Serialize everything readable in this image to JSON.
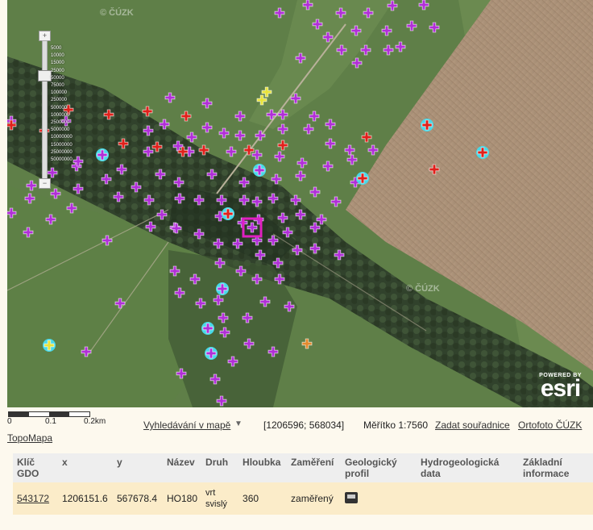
{
  "watermarks": {
    "top": "© ČÚZK",
    "mid": "© ČÚZK"
  },
  "zoom": {
    "plus": "+",
    "minus": "−",
    "scales": [
      "5000",
      "10000",
      "15000",
      "25000",
      "50000",
      "75000",
      "100000",
      "250000",
      "500000",
      "1000000",
      "2500000",
      "5000000",
      "10000000",
      "15000000",
      "25000000",
      "50000000"
    ],
    "level_fraction": 0.23
  },
  "esri": {
    "powered": "POWERED BY",
    "name": "esri"
  },
  "scale": {
    "l0": "0",
    "l1": "0.1",
    "l2": "0.2km"
  },
  "toolbar": {
    "search": "Vyhledávání v mapě",
    "coords": "[1206596; 568034]",
    "scale": "Měřítko 1:7560",
    "enter_coords": "Zadat souřadnice",
    "ortho": "Ortofoto ČÚZK",
    "topo": "TopoMapa"
  },
  "table": {
    "headers": [
      "Klíč GDO",
      "x",
      "y",
      "Název",
      "Druh",
      "Hloubka",
      "Zaměření",
      "Geologický profil",
      "Hydrogeologická data",
      "Základní informace"
    ],
    "row": {
      "key": "543172",
      "x": "1206151.6",
      "y": "567678.4",
      "name": "HO180",
      "type": "vrt svislý",
      "depth": "360",
      "survey": "zaměřený"
    }
  },
  "colors": {
    "purple": "#b12ed8",
    "red": "#e0201b",
    "yellow": "#e8e33a",
    "orange": "#e38a2e",
    "cyan": "#48d8e8",
    "highlight": "#e020c0"
  }
}
